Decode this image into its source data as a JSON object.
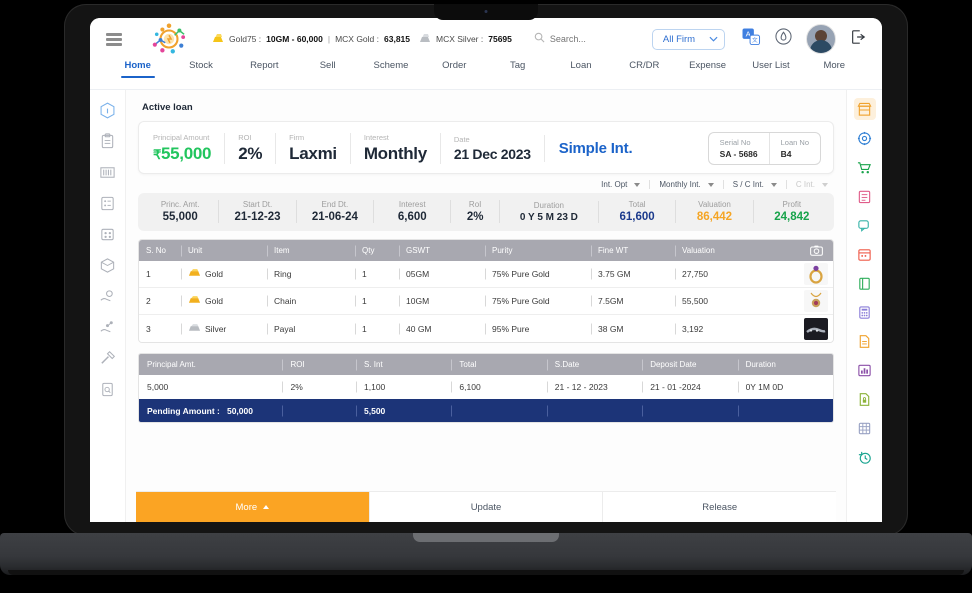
{
  "topbar": {
    "menu_icon": "hamburger-icon",
    "logo_icon": "app-logo-icon",
    "rates": [
      {
        "icon": "gold-bar-icon",
        "label": "Gold75 :",
        "value": "10GM - 60,000"
      },
      {
        "sep": "|",
        "label": "MCX Gold :",
        "value": "63,815"
      },
      {
        "icon": "silver-bar-icon",
        "label": "MCX Silver :",
        "value": "75695"
      }
    ],
    "search": {
      "icon": "search-icon",
      "placeholder": "Search...",
      "value": ""
    },
    "firm_select": {
      "label": "All Firm",
      "icon": "chevron-down-icon"
    },
    "actions": [
      {
        "name": "translate-icon"
      },
      {
        "name": "notification-bell-icon"
      },
      {
        "name": "avatar"
      },
      {
        "name": "logout-icon"
      }
    ]
  },
  "nav": {
    "items": [
      {
        "label": "Home",
        "active": true
      },
      {
        "label": "Stock",
        "active": false
      },
      {
        "label": "Report",
        "active": false
      },
      {
        "label": "Sell",
        "active": false
      },
      {
        "label": "Scheme",
        "active": false
      },
      {
        "label": "Order",
        "active": false
      },
      {
        "label": "Tag",
        "active": false
      },
      {
        "label": "Loan",
        "active": false
      },
      {
        "label": "CR/DR",
        "active": false
      },
      {
        "label": "Expense",
        "active": false
      },
      {
        "label": "User List",
        "active": false
      },
      {
        "label": "More",
        "active": false
      }
    ]
  },
  "left_rail": {
    "items": [
      {
        "name": "info-icon"
      },
      {
        "name": "clipboard-icon"
      },
      {
        "name": "barcode-icon"
      },
      {
        "name": "list-check-icon"
      },
      {
        "name": "grid-dots-icon"
      },
      {
        "name": "box-package-icon"
      },
      {
        "name": "hand-coin-icon"
      },
      {
        "name": "hand-share-icon"
      },
      {
        "name": "hammer-icon"
      },
      {
        "name": "document-search-icon"
      }
    ]
  },
  "right_rail": {
    "items": [
      {
        "name": "store-icon",
        "color": "#f0a22e",
        "selected": true
      },
      {
        "name": "settings-gear-icon",
        "color": "#2f7fd4",
        "selected": false
      },
      {
        "name": "shopping-cart-icon",
        "color": "#17a34a",
        "selected": false
      },
      {
        "name": "clipboard-pink-icon",
        "color": "#e05c8a",
        "selected": false
      },
      {
        "name": "chat-bubble-icon",
        "color": "#36b3a8",
        "selected": false
      },
      {
        "name": "calendar-red-icon",
        "color": "#ef5b49",
        "selected": false
      },
      {
        "name": "book-green-icon",
        "color": "#2fae5b",
        "selected": false
      },
      {
        "name": "calculator-icon",
        "color": "#8b7ed8",
        "selected": false
      },
      {
        "name": "file-orange-icon",
        "color": "#f0a22e",
        "selected": false
      },
      {
        "name": "chart-purple-icon",
        "color": "#8b4fa8",
        "selected": false
      },
      {
        "name": "lock-file-icon",
        "color": "#8cb33a",
        "selected": false
      },
      {
        "name": "spreadsheet-icon",
        "color": "#9aa3c4",
        "selected": false
      },
      {
        "name": "history-clock-icon",
        "color": "#17a38f",
        "selected": false
      }
    ]
  },
  "loan": {
    "card_title": "Active loan",
    "summary": [
      {
        "label": "Principal Amount",
        "value": "55,000",
        "prefix": "₹",
        "color": "green"
      },
      {
        "label": "ROI",
        "value": "2%",
        "prefix": "",
        "color": "dark"
      },
      {
        "label": "Firm",
        "value": "Laxmi",
        "prefix": "",
        "color": "dark"
      },
      {
        "label": "Interest",
        "value": "Monthly",
        "prefix": "",
        "color": "dark"
      },
      {
        "label": "Date",
        "value": "21 Dec 2023",
        "prefix": "",
        "color": "dark"
      }
    ],
    "interest_type": "Simple Int.",
    "serial": {
      "label": "Serial No",
      "value": "SA - 5686"
    },
    "loan_no": {
      "label": "Loan No",
      "value": "B4"
    },
    "options": [
      {
        "label": "Int. Opt",
        "dim": false
      },
      {
        "label": "Monthly Int.",
        "dim": false
      },
      {
        "label": "S / C Int.",
        "dim": false
      },
      {
        "label": "C Int.",
        "dim": true
      }
    ],
    "stats": [
      {
        "label": "Princ. Amt.",
        "value": "55,000",
        "color": "dark"
      },
      {
        "label": "Start Dt.",
        "value": "21-12-23",
        "color": "dark"
      },
      {
        "label": "End Dt.",
        "value": "21-06-24",
        "color": "dark"
      },
      {
        "label": "Interest",
        "value": "6,600",
        "color": "dark"
      },
      {
        "label": "RoI",
        "value": "2%",
        "color": "dark"
      },
      {
        "label": "Duration",
        "value": "0 Y 5 M 23 D",
        "color": "dark-small"
      },
      {
        "label": "Total",
        "value": "61,600",
        "color": "blue"
      },
      {
        "label": "Valuation",
        "value": "86,442",
        "color": "orange"
      },
      {
        "label": "Profit",
        "value": "24,842",
        "color": "green"
      }
    ]
  },
  "items_table": {
    "columns": [
      "S. No",
      "Unit",
      "Item",
      "Qty",
      "GSWT",
      "Purity",
      "Fine WT",
      "Valuation"
    ],
    "image_col_icon": "camera-icon",
    "rows": [
      {
        "sno": "1",
        "unit": "Gold",
        "unit_icon": "gold-nugget-icon",
        "item": "Ring",
        "qty": "1",
        "gswt": "05GM",
        "purity": "75% Pure Gold",
        "fine_wt": "3.75 GM",
        "valuation": "27,750",
        "thumb": "ring-photo"
      },
      {
        "sno": "2",
        "unit": "Gold",
        "unit_icon": "gold-nugget-icon",
        "item": "Chain",
        "qty": "1",
        "gswt": "10GM",
        "purity": "75% Pure Gold",
        "fine_wt": "7.5GM",
        "valuation": "55,500",
        "thumb": "chain-photo"
      },
      {
        "sno": "3",
        "unit": "Silver",
        "unit_icon": "silver-bar-icon",
        "item": "Payal",
        "qty": "1",
        "gswt": "40 GM",
        "purity": "95% Pure",
        "fine_wt": "38 GM",
        "valuation": "3,192",
        "thumb": "payal-photo"
      }
    ]
  },
  "ledger_table": {
    "columns": [
      "Principal Amt.",
      "ROI",
      "S. Int",
      "Total",
      "S.Date",
      "Deposit Date",
      "Duration"
    ],
    "rows": [
      {
        "principal": "5,000",
        "roi": "2%",
        "s_int": "1,100",
        "total": "6,100",
        "s_date": "21 - 12 - 2023",
        "deposit_date": "21 - 01 -2024",
        "duration": "0Y 1M 0D"
      }
    ],
    "pending": {
      "label": "Pending Amount :",
      "amount": "50,000",
      "interest": "5,500"
    }
  },
  "footer": {
    "buttons": [
      {
        "label": "More",
        "primary": true,
        "icon": "chevron-up-icon"
      },
      {
        "label": "Update",
        "primary": false
      },
      {
        "label": "Release",
        "primary": false
      }
    ]
  }
}
